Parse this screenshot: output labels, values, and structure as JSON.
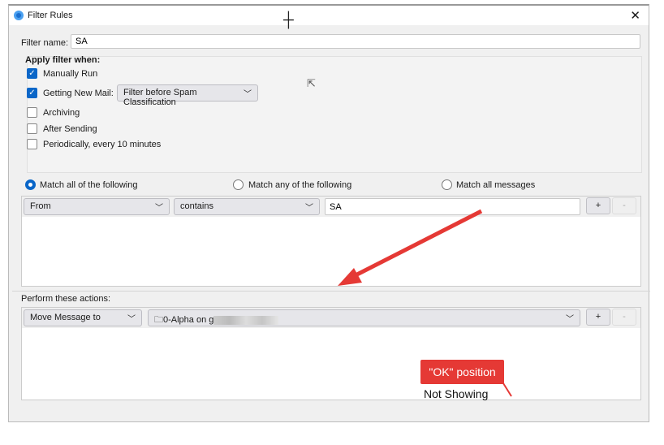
{
  "window": {
    "title": "Filter Rules",
    "close": "✕"
  },
  "filter_name": {
    "label": "Filter name:",
    "value": "SA"
  },
  "apply": {
    "heading": "Apply filter when:",
    "manual": "Manually Run",
    "new_mail": "Getting New Mail:",
    "new_mail_option": "Filter before Spam Classification",
    "archiving": "Archiving",
    "after_sending": "After Sending",
    "periodically": "Periodically, every 10 minutes"
  },
  "match": {
    "all": "Match all of the following",
    "any": "Match any of the following",
    "all_messages": "Match all messages"
  },
  "rule": {
    "field": "From",
    "operator": "contains",
    "value": "SA",
    "add": "+",
    "remove": "-"
  },
  "actions": {
    "heading": "Perform these actions:",
    "action": "Move Message to",
    "folder": "0-Alpha on g",
    "add": "+",
    "remove": "-"
  },
  "annotation": {
    "callout": "\"OK\" position",
    "note": "Not Showing",
    "color": "#e53935"
  }
}
